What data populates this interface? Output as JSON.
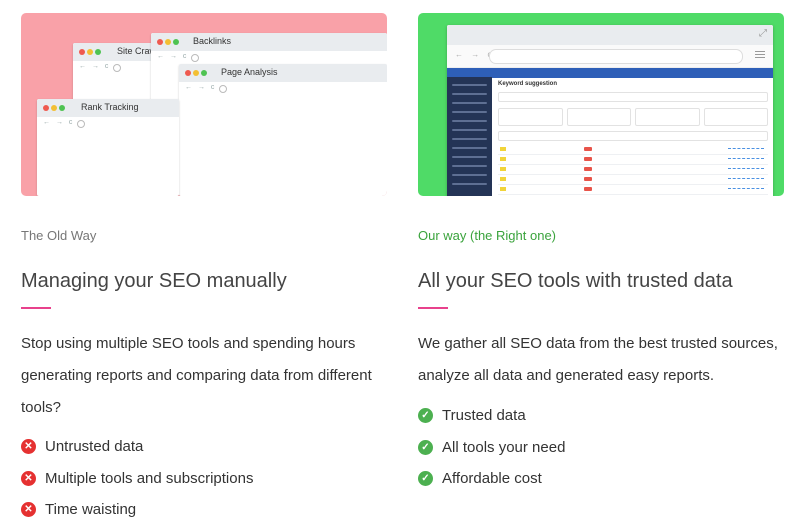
{
  "old": {
    "windows": [
      {
        "title": "Site Crawl"
      },
      {
        "title": "Backlinks"
      },
      {
        "title": "Page Analysis"
      },
      {
        "title": "Rank Tracking"
      }
    ],
    "label": "The Old Way",
    "heading": "Managing your SEO manually",
    "paragraph": "Stop using multiple SEO tools and spending hours generating reports and comparing data from different tools?",
    "items": [
      "Untrusted data",
      "Multiple tools and subscriptions",
      "Time waisting"
    ]
  },
  "new": {
    "app_title": "Keyword suggestion",
    "label": "Our way (the Right one)",
    "heading": "All your SEO tools with trusted data",
    "paragraph": "We gather all SEO data from the best trusted sources, analyze all data and generated easy reports.",
    "items": [
      "Trusted data",
      "All tools your need",
      "Affordable cost"
    ]
  },
  "colors": {
    "pink": "#f9a1a8",
    "green": "#4fdb67",
    "accent": "#e8418c",
    "cross": "#e53131",
    "check": "#4cb050"
  },
  "icons": {
    "bad": "circle-x-icon",
    "good": "circle-check-icon"
  }
}
